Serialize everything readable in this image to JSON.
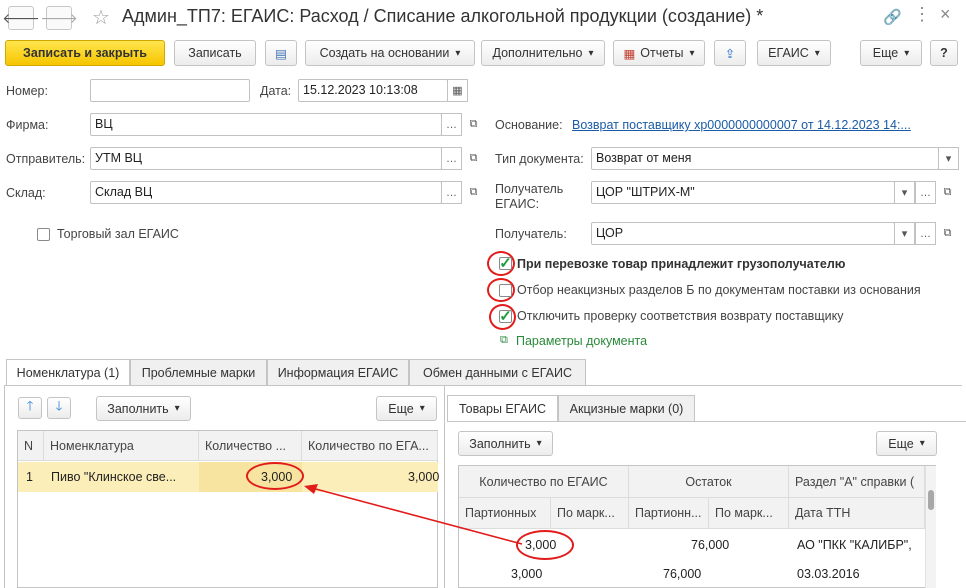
{
  "window": {
    "title": "Админ_ТП7: ЕГАИС: Расход / Списание алкогольной продукции (создание) *"
  },
  "toolbar": {
    "save_close": "Записать и закрыть",
    "save": "Записать",
    "create_based": "Создать на основании",
    "additional": "Дополнительно",
    "reports": "Отчеты",
    "egais": "ЕГАИС",
    "more": "Еще",
    "help": "?"
  },
  "form": {
    "number_label": "Номер:",
    "number_value": "",
    "date_label": "Дата:",
    "date_value": "15.12.2023 10:13:08",
    "firm_label": "Фирма:",
    "firm_value": "ВЦ",
    "sender_label": "Отправитель:",
    "sender_value": "УТМ ВЦ",
    "warehouse_label": "Склад:",
    "warehouse_value": "Склад ВЦ",
    "trade_hall_label": "Торговый зал ЕГАИС",
    "basis_label": "Основание:",
    "basis_value": "Возврат поставщику хр0000000000007 от 14.12.2023 14:...",
    "doctype_label": "Тип документа:",
    "doctype_value": "Возврат от меня",
    "recipient_egais_label": "Получатель ЕГАИС:",
    "recipient_egais_value": "ЦОР \"ШТРИХ-М\"",
    "recipient_label": "Получатель:",
    "recipient_value": "ЦОР",
    "cb1_label": "При перевозке товар принадлежит грузополучателю",
    "cb1_checked": true,
    "cb2_label": "Отбор неакцизных разделов Б по документам поставки из основания",
    "cb2_checked": false,
    "cb3_label": "Отключить проверку соответствия возврату поставщику",
    "cb3_checked": true,
    "params_link": "Параметры документа"
  },
  "tabs": [
    {
      "label": "Номенклатура (1)"
    },
    {
      "label": "Проблемные марки"
    },
    {
      "label": "Информация ЕГАИС"
    },
    {
      "label": "Обмен данными с ЕГАИС"
    }
  ],
  "left_panel": {
    "fill": "Заполнить",
    "more": "Еще",
    "headers": [
      "N",
      "Номенклатура",
      "Количество ...",
      "Количество по ЕГА..."
    ],
    "rows": [
      {
        "n": "1",
        "name": "Пиво \"Клинское све...",
        "qty": "3,000",
        "qty_egais": "3,000"
      }
    ]
  },
  "right_panel": {
    "tabs": [
      {
        "label": "Товары ЕГАИС"
      },
      {
        "label": "Акцизные марки (0)"
      }
    ],
    "fill": "Заполнить",
    "more": "Еще",
    "group_headers": [
      "Количество по ЕГАИС",
      "Остаток",
      "Раздел \"А\" справки ("
    ],
    "sub_headers": [
      "Партионных",
      "По марк...",
      "Партионн...",
      "По марк...",
      "Дата ТТН"
    ],
    "rows": [
      {
        "c1": "3,000",
        "c2": "",
        "c3": "76,000",
        "c4": "",
        "c5": "АО \"ПКК \"КАЛИБР\","
      },
      {
        "c1": "3,000",
        "c2": "",
        "c3": "76,000",
        "c4": "",
        "c5": "03.03.2016"
      }
    ]
  },
  "colors": {
    "primary": "#f6c500",
    "link": "#1a5ba6",
    "check": "#1e9b3e",
    "annotation": "#e21b1b",
    "selected_row": "#fbeeb8"
  }
}
